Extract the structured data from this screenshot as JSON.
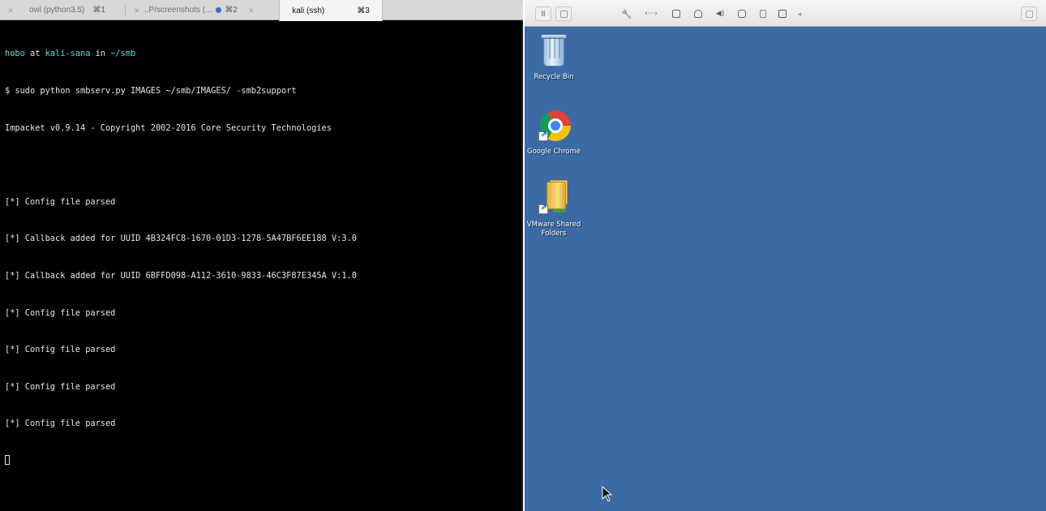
{
  "terminal": {
    "tabs": [
      {
        "close": "×",
        "title": "owl (python3.5)",
        "shortcut": "⌘1"
      },
      {
        "close": "×",
        "title": "..P/screenshots (...",
        "shortcut": "⌘2",
        "close_right": "×"
      },
      {
        "title": "kali (ssh)",
        "shortcut": "⌘3"
      }
    ],
    "prompt": {
      "user": "hobo",
      "at": " at ",
      "host": "kali-sana",
      "in": " in ",
      "path": "~/smb"
    },
    "lines": [
      "$ sudo python smbserv.py IMAGES ~/smb/IMAGES/ -smb2support",
      "Impacket v0.9.14 - Copyright 2002-2016 Core Security Technologies",
      "",
      "[*] Config file parsed",
      "[*] Callback added for UUID 4B324FC8-1670-01D3-1278-5A47BF6EE188 V:3.0",
      "[*] Callback added for UUID 6BFFD098-A112-3610-9833-46C3F87E345A V:1.0",
      "[*] Config file parsed",
      "[*] Config file parsed",
      "[*] Config file parsed",
      "[*] Config file parsed"
    ]
  },
  "vm": {
    "toolbar_icons": [
      "pause-icon",
      "display-icon",
      "wrench-icon",
      "arrows-icon",
      "disk-icon",
      "lock-icon",
      "speaker-icon",
      "camera-icon",
      "usb-icon",
      "refresh-icon",
      "arrow-left-icon",
      "window-icon"
    ],
    "toolbar_glyphs": {
      "pause": "II",
      "wrench": "🔧",
      "arrows": "‹···›",
      "speaker": "◀)",
      "arrow_left": "◂"
    },
    "desktop_icons": [
      {
        "label": "Recycle Bin"
      },
      {
        "label": "Google Chrome"
      },
      {
        "label": "VMware Shared Folders"
      }
    ],
    "desktop_color": "#3b6aa4"
  },
  "colors": {
    "terminal_bg": "#000000",
    "prompt_cyan": "#5fd7e0",
    "tab_active": "#f4f4f4"
  }
}
